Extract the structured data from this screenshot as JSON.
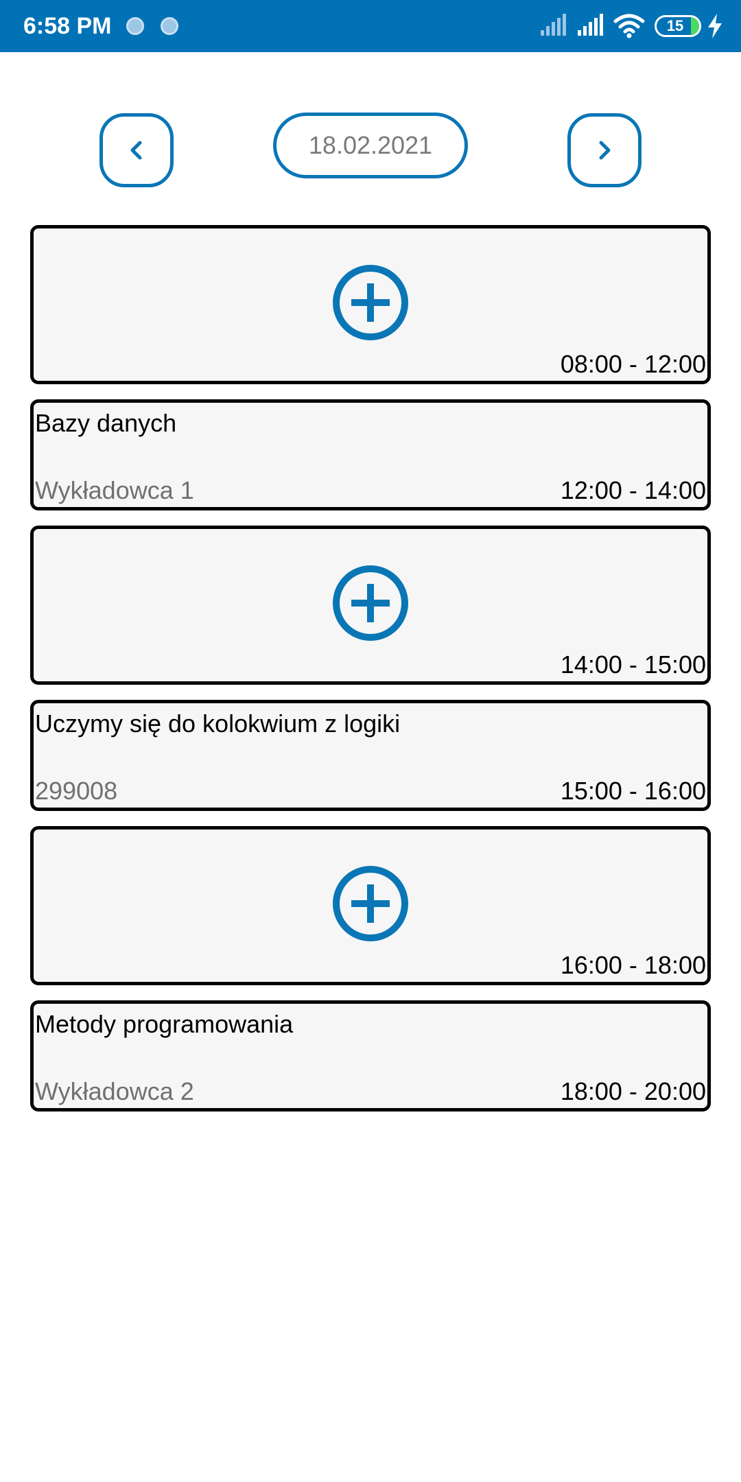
{
  "status_bar": {
    "time": "6:58 PM",
    "battery_level": "15",
    "icons": [
      "notification-dot-icon",
      "notification-dot-icon",
      "signal-icon",
      "signal-icon",
      "wifi-icon",
      "battery-icon",
      "charging-icon"
    ],
    "background_color": "#0072b5"
  },
  "date_nav": {
    "date": "18.02.2021",
    "prev_icon": "chevron-left-icon",
    "next_icon": "chevron-right-icon",
    "accent_color": "#0a76b6"
  },
  "slots": [
    {
      "type": "empty",
      "time": "08:00 - 12:00",
      "icon": "add-circle-icon"
    },
    {
      "type": "lesson",
      "title": "Bazy danych",
      "subtitle": "Wykładowca 1",
      "time": "12:00 - 14:00"
    },
    {
      "type": "empty",
      "time": "14:00 - 15:00",
      "icon": "add-circle-icon"
    },
    {
      "type": "lesson",
      "title": "Uczymy się do kolokwium z logiki",
      "subtitle": "299008",
      "time": "15:00 - 16:00"
    },
    {
      "type": "empty",
      "time": "16:00 - 18:00",
      "icon": "add-circle-icon"
    },
    {
      "type": "lesson",
      "title": "Metody programowania",
      "subtitle": "Wykładowca 2",
      "time": "18:00 - 20:00"
    }
  ]
}
